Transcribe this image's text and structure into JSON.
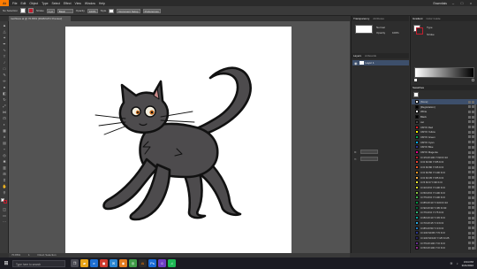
{
  "menubar": {
    "logo": "Ai",
    "items": [
      "File",
      "Edit",
      "Object",
      "Type",
      "Select",
      "Effect",
      "View",
      "Window",
      "Help"
    ],
    "right_label": "Essentials"
  },
  "controlbar": {
    "selection_label": "No Selection",
    "stroke_label": "Stroke",
    "stroke_value": "1 pt",
    "brush_label": "Basic",
    "opacity_label": "Opacity",
    "opacity_value": "100%",
    "style_label": "Style",
    "doc_setup": "Document Setup",
    "preferences": "Preferences"
  },
  "document": {
    "tab_label": "toothless.ai @ 70.86% (RGB/GPU Preview)"
  },
  "status": {
    "zoom": "70.86%",
    "artboard": "1",
    "tool": "Direct Selection"
  },
  "panel_a": {
    "tabs": [
      "Transparency",
      "Attributes"
    ],
    "blend_mode": "Normal",
    "opacity_label": "Opacity",
    "opacity_value": "100%",
    "layers_tabs": [
      "Layers",
      "Artboards"
    ],
    "layers": [
      {
        "name": "Layer 1"
      }
    ],
    "x_label": "X:",
    "y_label": "Y:"
  },
  "panel_b": {
    "tabs": [
      "Gradient",
      "Color Guide"
    ],
    "gradient_type": "Type",
    "stroke_label": "Stroke",
    "swatches_tabs": [
      "Swatches"
    ],
    "swatches": [
      {
        "name": "[None]",
        "color": "#ffffff",
        "selected": true
      },
      {
        "name": "[Registration]",
        "color": "#000000"
      },
      {
        "name": "White",
        "color": "#ffffff"
      },
      {
        "name": "Black",
        "color": "#000000"
      },
      {
        "name": "cat",
        "color": "#4b4b4b"
      },
      {
        "name": "CMYK Red",
        "color": "#e41e26"
      },
      {
        "name": "CMYK Yellow",
        "color": "#fff200"
      },
      {
        "name": "CMYK Green",
        "color": "#00a651"
      },
      {
        "name": "CMYK Cyan",
        "color": "#00aeef"
      },
      {
        "name": "CMYK Blue",
        "color": "#2e3192"
      },
      {
        "name": "CMYK Magenta",
        "color": "#ec008c"
      },
      {
        "name": "C=15 M=100 Y=90 K=10",
        "color": "#be1e2d"
      },
      {
        "name": "C=0 M=90 Y=85 K=0",
        "color": "#ef4136"
      },
      {
        "name": "C=0 M=80 Y=95 K=0",
        "color": "#f15a29"
      },
      {
        "name": "C=0 M=50 Y=100 K=0",
        "color": "#f7941d"
      },
      {
        "name": "C=0 M=35 Y=85 K=0",
        "color": "#fbb040"
      },
      {
        "name": "C=5 M=0 Y=90 K=0",
        "color": "#f9ed32"
      },
      {
        "name": "C=20 M=0 Y=100 K=0",
        "color": "#d7df23"
      },
      {
        "name": "C=50 M=0 Y=100 K=0",
        "color": "#8dc63f"
      },
      {
        "name": "C=75 M=0 Y=100 K=0",
        "color": "#39b54a"
      },
      {
        "name": "C=85 M=10 Y=100 K=10",
        "color": "#009444"
      },
      {
        "name": "C=90 M=30 Y=95 K=30",
        "color": "#006838"
      },
      {
        "name": "C=75 M=0 Y=75 K=0",
        "color": "#2bb673"
      },
      {
        "name": "C=80 M=10 Y=45 K=0",
        "color": "#00a79d"
      },
      {
        "name": "C=70 M=15 Y=0 K=0",
        "color": "#27aae1"
      },
      {
        "name": "C=85 M=50 Y=0 K=0",
        "color": "#1c75bc"
      },
      {
        "name": "C=100 M=95 Y=5 K=0",
        "color": "#2b3990"
      },
      {
        "name": "C=100 M=100 Y=25 K=25",
        "color": "#262262"
      },
      {
        "name": "C=75 M=100 Y=0 K=0",
        "color": "#662d91"
      },
      {
        "name": "C=50 M=100 Y=0 K=0",
        "color": "#92278f"
      }
    ]
  },
  "taskbar": {
    "search_placeholder": "Type here to search",
    "time": "3:04 PM",
    "date": "3/21/2022"
  }
}
